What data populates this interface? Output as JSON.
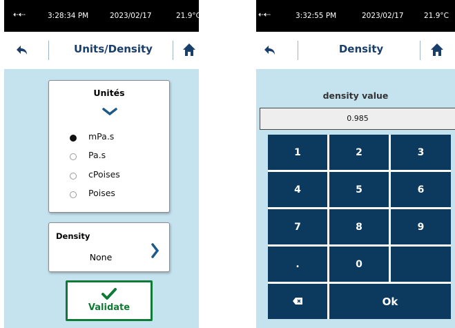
{
  "left": {
    "status": {
      "time": "3:28:34 PM",
      "date": "2023/02/17",
      "temp": "21.9°C",
      "usb_glyph": "⇠⇠"
    },
    "header": {
      "title": "Units/Density"
    },
    "units": {
      "title": "Unités",
      "options": [
        {
          "label": "mPa.s",
          "selected": true
        },
        {
          "label": "Pa.s",
          "selected": false
        },
        {
          "label": "cPoises",
          "selected": false
        },
        {
          "label": "Poises",
          "selected": false
        }
      ]
    },
    "density": {
      "title": "Density",
      "value": "None"
    },
    "validate_label": "Validate"
  },
  "right": {
    "status": {
      "time": "3:32:55 PM",
      "date": "2023/02/17",
      "temp": "21.9°C",
      "usb_glyph": "⇠⇠"
    },
    "header": {
      "title": "Density"
    },
    "density_label": "density value",
    "density_input": "0.985",
    "keys": [
      "1",
      "2",
      "3",
      "4",
      "5",
      "6",
      "7",
      "8",
      "9",
      ".",
      "0",
      "",
      "⌫",
      "Ok"
    ]
  },
  "colors": {
    "navy": "#0b3a5e",
    "background": "#c5e2ef",
    "validate_green": "#0f7a35",
    "title_blue": "#1a3e6b"
  }
}
